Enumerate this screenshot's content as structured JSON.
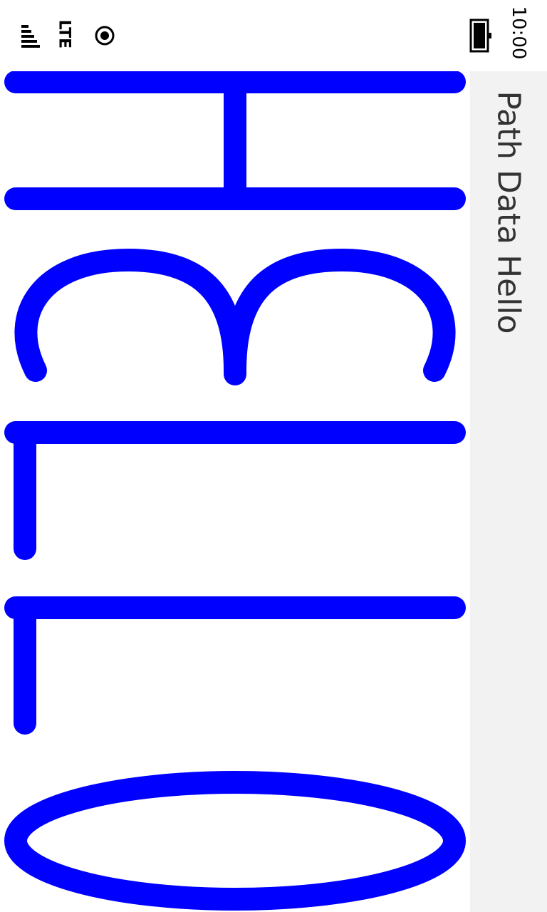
{
  "status_bar": {
    "time": "10:00",
    "network": "LTE",
    "signal_icon": "signal-strength-icon",
    "location_icon": "location-icon",
    "battery_icon": "battery-icon"
  },
  "page": {
    "title": "Path Data Hello"
  },
  "drawing": {
    "stroke_color": "#0000FF",
    "letters": [
      "H",
      "E",
      "L",
      "L",
      "O"
    ]
  }
}
